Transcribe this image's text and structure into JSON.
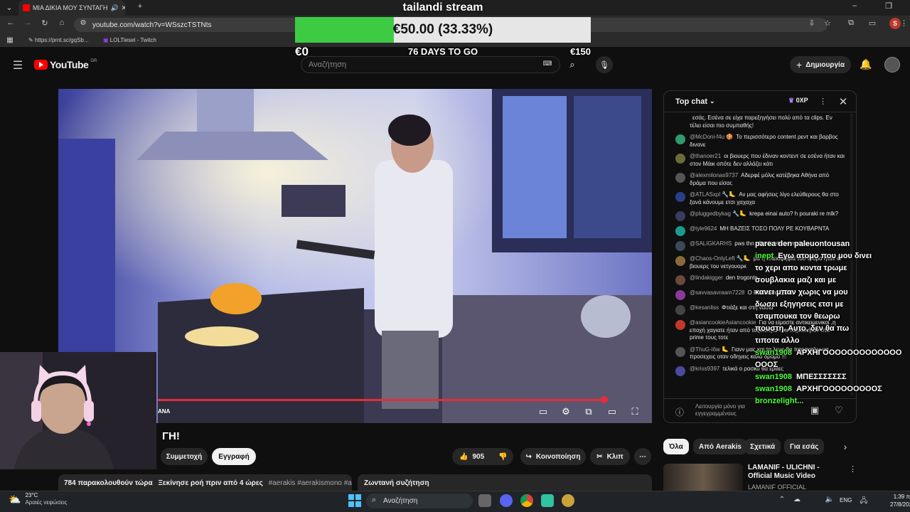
{
  "browser": {
    "tab_title": "ΜΙΑ ΔΙΚΙΑ ΜΟΥ ΣΥΝΤΑΓΗ",
    "url": "youtube.com/watch?v=WSszcTSTNts",
    "bookmarks": [
      "https://prnt.sc/gqSb...",
      "LOLTiesel - Twitch"
    ],
    "profile_letter": "S"
  },
  "youtube": {
    "logo_text": "YouTube",
    "region": "GR",
    "search_placeholder": "Αναζήτηση",
    "create_label": "Δημιουργία"
  },
  "donation": {
    "stream_name": "tailandi stream",
    "amount_text": "€50.00 (33.33%)",
    "progress": 0.3333,
    "min": "€0",
    "max": "€150",
    "days_left": "76 DAYS TO GO",
    "colors": {
      "fill": "#3ecb44",
      "empty": "#e6e6e6"
    }
  },
  "video": {
    "title_fragment": "ΓΗ!",
    "channel_fragment": "ANA",
    "progress_fraction": 0.97,
    "subscribe_label": "Συμμετοχή",
    "join_label": "Εγγραφή",
    "like_count": "905",
    "share_label": "Κοινοποίηση",
    "clip_label": "Κλιπ",
    "viewers": "784 παρακολουθούν τώρα",
    "started": "Ξεκίνησε ροή πριν από 4 ώρες",
    "tags": "#aerakis #aerakismono #aerakis",
    "live_chat_label": "Ζωντανή συζήτηση"
  },
  "chat": {
    "header": "Top chat",
    "badge": "0XP",
    "messages": [
      {
        "author": "",
        "text": "εσάς. Εσένα σε είχα παρεξηγήσει πολύ από τα clips. Εν τέλει είσαι πιο συμπαθής!",
        "color": "#0f0f0f"
      },
      {
        "author": "@McDoni-f4u 🍪",
        "text": "Το περισσότερο content ρεντ και βαρβος δινανε",
        "color": "#2e9b6e"
      },
      {
        "author": "@thanoer21",
        "text": "οι βιουερς που έδιναν κοντεντ σε εσένα ήταν και στον Μάικ οπότε δεν αλλάζει κάτι",
        "color": "#6b6b3a"
      },
      {
        "author": "@alexmilonas9737",
        "text": "Αδερφέ μόλις κατέβηκα Αθήνα από δράμα που είσαι;",
        "color": "#555"
      },
      {
        "author": "@ATLASxpl 🔧🦶",
        "text": "Αν μας αφήσεις λίγο ελεύθερους θα στο ξανά κάνουμε ετσι χαχαχα",
        "color": "#2a3f8a"
      },
      {
        "author": "@pluggedbykag 🔧🦶",
        "text": "krepa einai auto? h pouraki re mlk?",
        "color": "#3b3b5c"
      },
      {
        "author": "@tyle9624",
        "text": "ΜΗ ΒΑΖΕΙΣ ΤΟΣΟ ΠΟΛΥ ΡΕ ΚΟΥΒΑΡΝΤΑ",
        "color": "#1a9c8c"
      },
      {
        "author": "@SALIGKARHS",
        "text": "pws thn aftenis etsi re malaka",
        "color": "#3a4a5a"
      },
      {
        "author": "@Chaos-OnlyLeft 🔧🦶",
        "text": "μα η πλειοψηφία του τροβο ηταν οι βιουερς του νετγουορκ",
        "color": "#8a6a3a"
      },
      {
        "author": "@lindakigger",
        "text": "den trogonte",
        "color": "#6a4a3a"
      },
      {
        "author": "@savvasavraam7228",
        "text": "Ο Ρασκο θα έρθει;",
        "color": "#8a3a9a"
      },
      {
        "author": "@kesanliss",
        "text": "Φτιάξε και στη νασια",
        "color": "#444"
      },
      {
        "author": "@asiancookieAsiancookie",
        "text": "Για να είμαστε αντικειμενικοί ,η εποχή χαγιατε ήταν από τοξικότητα ...οι τοξικοί ήταν στα prime τους τοτε",
        "color": "#c0392b"
      },
      {
        "author": "@ThuG-i6w 🦶",
        "text": "Γιανν μας και τα λεμε θα παρακαλω να προσεχεις οταν οδηγεις καλο δρομο !!!",
        "color": "#555"
      },
      {
        "author": "@kriss9397",
        "text": "τελικά ο ρασκο θα έρθει;",
        "color": "#4a4aa0"
      }
    ],
    "footer_text": "Λειτουργία μόνο για εγγεγραμμένους"
  },
  "overlay_chat": {
    "lines": [
      {
        "name": "",
        "text": "parea den paleuontousan"
      },
      {
        "name": "inept",
        "text": "Εγω ατομο που μου δινει"
      },
      {
        "name": "",
        "text": "το χερι απο κοντα τρωμε"
      },
      {
        "name": "",
        "text": "σουβλακια μαζι και με"
      },
      {
        "name": "",
        "text": "κανει μπαν χωρις να μου"
      },
      {
        "name": "",
        "text": "δωσει εξηγησεις ετσι με"
      },
      {
        "name": "",
        "text": "τσαμπουκα τον θεωρω"
      },
      {
        "name": "",
        "text": "πουστη. Αυτο, δεν θα πω"
      },
      {
        "name": "",
        "text": "τιποτα αλλο"
      },
      {
        "name": "swan1908",
        "text": "ΑΡΧΗΓΟΟΟΟΟΟΟΟΟΟΟΟΟ"
      },
      {
        "name": "",
        "text": "ΟΟΟΣ"
      },
      {
        "name": "swan1908",
        "text": "ΜΠΕΣΣΣΣΣΣΣ"
      },
      {
        "name": "swan1908",
        "text": "ΑΡΧΗΓΟΟΟΟΟΟΟΟΟΣ"
      },
      {
        "name": "bronzelight...",
        "text": ""
      }
    ]
  },
  "chips": [
    "Όλα",
    "Από Aerakis",
    "Σχετικά",
    "Για εσάς"
  ],
  "recommended": {
    "title": "LAMANIF - ULICHNI - Official Music Video",
    "channel": "LAMANIF OFFICIAL"
  },
  "taskbar": {
    "weather_temp": "23°C",
    "weather_desc": "Αραιές νεφώσεις",
    "search_label": "Αναζήτηση",
    "lang": "ENG",
    "time": "1:39 π",
    "date": "27/8/202"
  }
}
